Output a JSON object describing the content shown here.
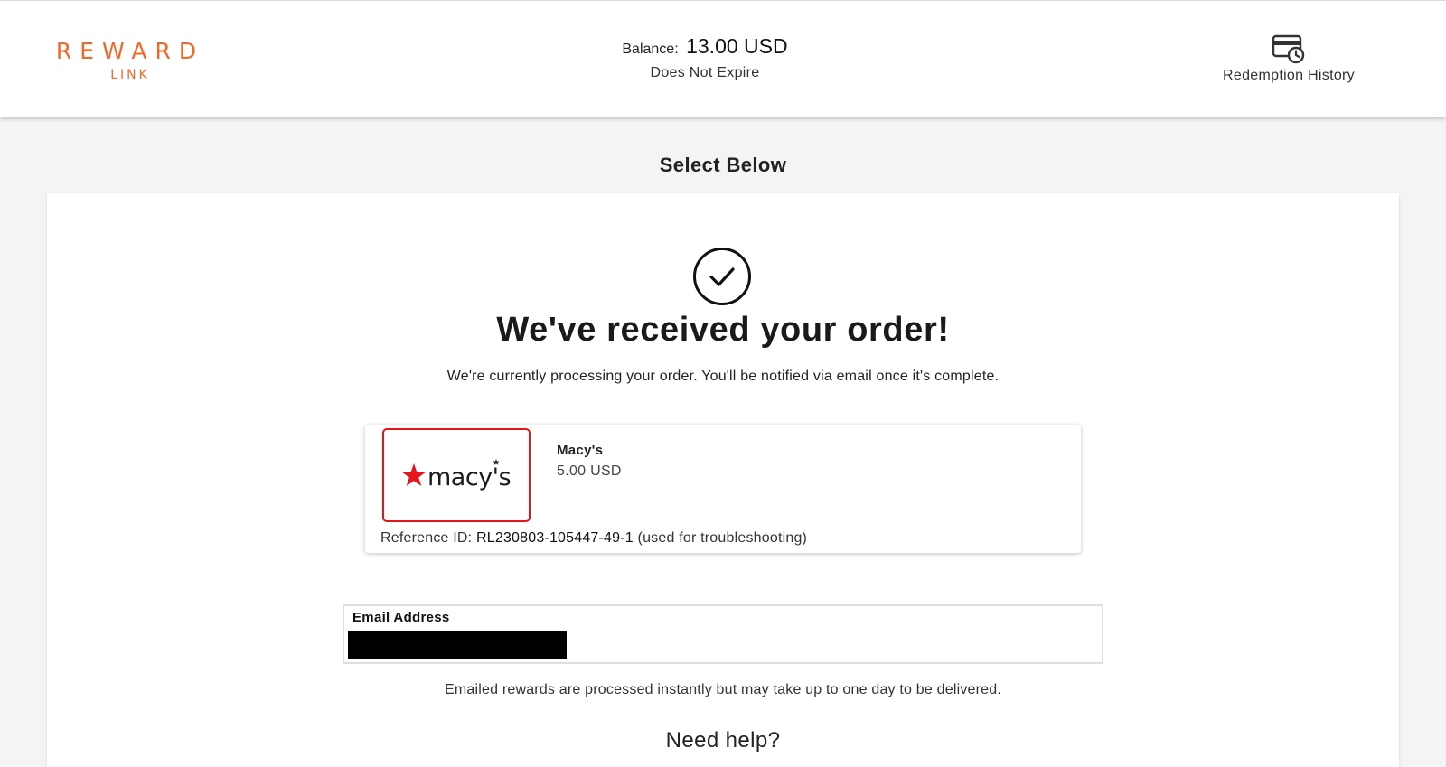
{
  "header": {
    "logo": {
      "top": "REWARD",
      "bottom": "LINK"
    },
    "balance": {
      "label": "Balance:",
      "value": "13.00 USD",
      "expiry": "Does Not Expire"
    },
    "redemption_history": {
      "label": "Redemption History",
      "icon": "card-clock-icon"
    }
  },
  "section_title": "Select Below",
  "confirmation": {
    "icon": "check-circle-icon",
    "headline": "We've received your order!",
    "message": "We're currently processing your order. You'll be notified via email once it's complete."
  },
  "order_item": {
    "brand_logo_text": "macy's",
    "name": "Macy's",
    "price": "5.00 USD",
    "reference_label": "Reference ID:",
    "reference_id": "RL230803-105447-49-1",
    "reference_note": "(used for troubleshooting)"
  },
  "email": {
    "label": "Email Address",
    "value": "",
    "note": "Emailed rewards are processed instantly but may take up to one day to be delivered."
  },
  "help_text": "Need help?",
  "colors": {
    "brand_orange": "#ef6a2a",
    "macys_red": "#e2161b",
    "page_bg": "#f4f4f4"
  }
}
